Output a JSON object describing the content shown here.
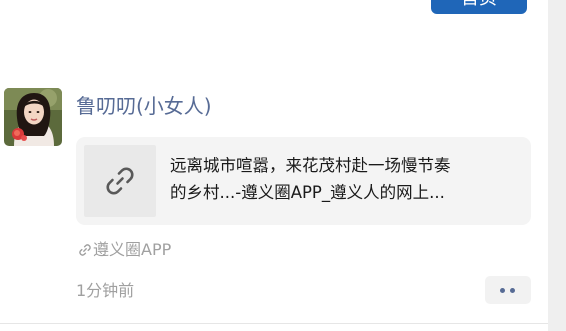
{
  "header": {
    "top_button_label": "首页"
  },
  "post": {
    "username": "鲁叨叨(小女人)",
    "avatar": "avatar-photo",
    "link_card": {
      "icon": "link-icon",
      "line1": "远离城市喧嚣，来花茂村赴一场慢节奏",
      "line2": "的乡村...-遵义圈APP_遵义人的网上..."
    },
    "source": {
      "icon": "link-small-icon",
      "label": "遵义圈APP"
    },
    "time": "1分钟前",
    "more": {
      "icon": "more-dots-icon"
    }
  },
  "colors": {
    "name": "#576b95",
    "meta": "#a0a0a0",
    "card_bg": "#f4f4f4",
    "accent_button": "#1f66b8"
  }
}
